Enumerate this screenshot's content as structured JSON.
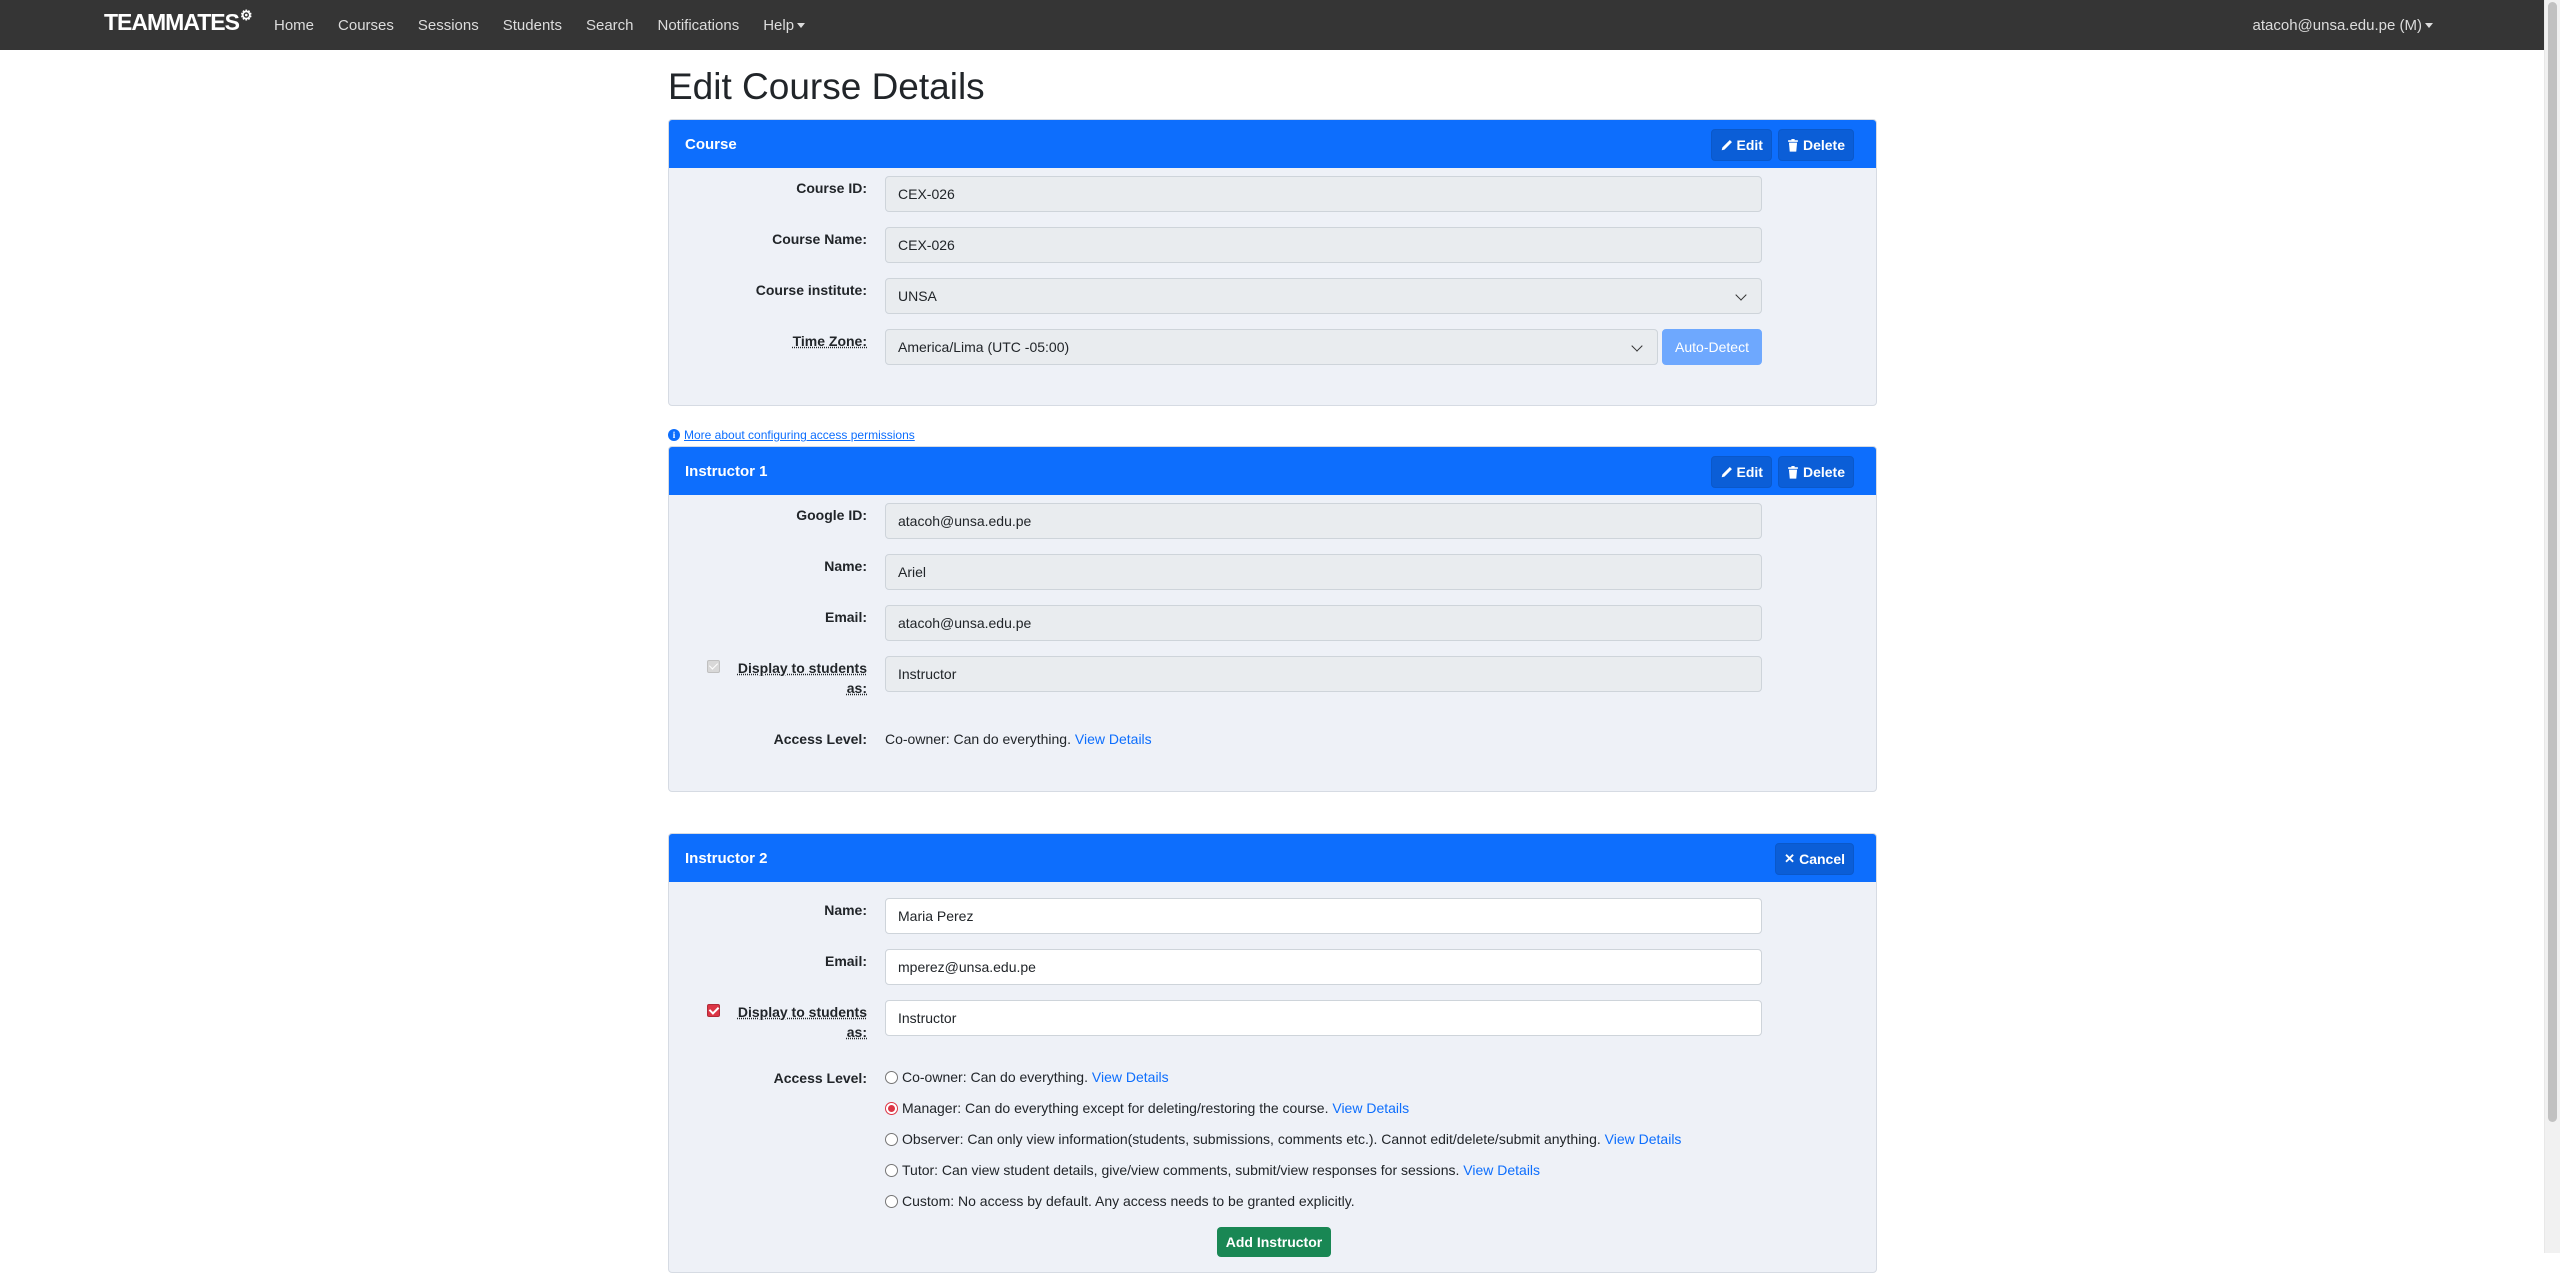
{
  "navbar": {
    "brand": "TEAMMATES",
    "links": [
      "Home",
      "Courses",
      "Sessions",
      "Students",
      "Search",
      "Notifications"
    ],
    "help": "Help",
    "user": "atacoh@unsa.edu.pe (M)"
  },
  "page_title": "Edit Course Details",
  "course": {
    "header": "Course",
    "edit": "Edit",
    "delete": "Delete",
    "id_label": "Course ID:",
    "id_value": "CEX-026",
    "name_label": "Course Name:",
    "name_value": "CEX-026",
    "institute_label": "Course institute:",
    "institute_value": "UNSA",
    "tz_label": "Time Zone:",
    "tz_value": "America/Lima (UTC -05:00)",
    "autodetect": "Auto-Detect"
  },
  "more_link": "More about configuring access permissions",
  "instructor1": {
    "header": "Instructor 1",
    "edit": "Edit",
    "delete": "Delete",
    "google_label": "Google ID:",
    "google_value": "atacoh@unsa.edu.pe",
    "name_label": "Name:",
    "name_value": "Ariel",
    "email_label": "Email:",
    "email_value": "atacoh@unsa.edu.pe",
    "display_label_1": "Display to students",
    "display_label_2": "as:",
    "display_value": "Instructor",
    "access_label": "Access Level:",
    "access_value": "Co-owner: Can do everything.",
    "view_details": "View Details"
  },
  "instructor2": {
    "header": "Instructor 2",
    "cancel": "Cancel",
    "name_label": "Name:",
    "name_value": "Maria Perez",
    "email_label": "Email:",
    "email_value": "mperez@unsa.edu.pe",
    "display_label_1": "Display to students",
    "display_label_2": "as:",
    "display_value": "Instructor",
    "access_label": "Access Level:",
    "options": [
      {
        "text": "Co-owner: Can do everything.",
        "details": "View Details"
      },
      {
        "text": "Manager: Can do everything except for deleting/restoring the course.",
        "details": "View Details"
      },
      {
        "text": "Observer: Can only view information(students, submissions, comments etc.). Cannot edit/delete/submit anything.",
        "details": "View Details"
      },
      {
        "text": "Tutor: Can view student details, give/view comments, submit/view responses for sessions.",
        "details": "View Details"
      },
      {
        "text": "Custom: No access by default. Any access needs to be granted explicitly.",
        "details": ""
      }
    ],
    "selected_option": "Manager",
    "add_button": "Add Instructor"
  }
}
